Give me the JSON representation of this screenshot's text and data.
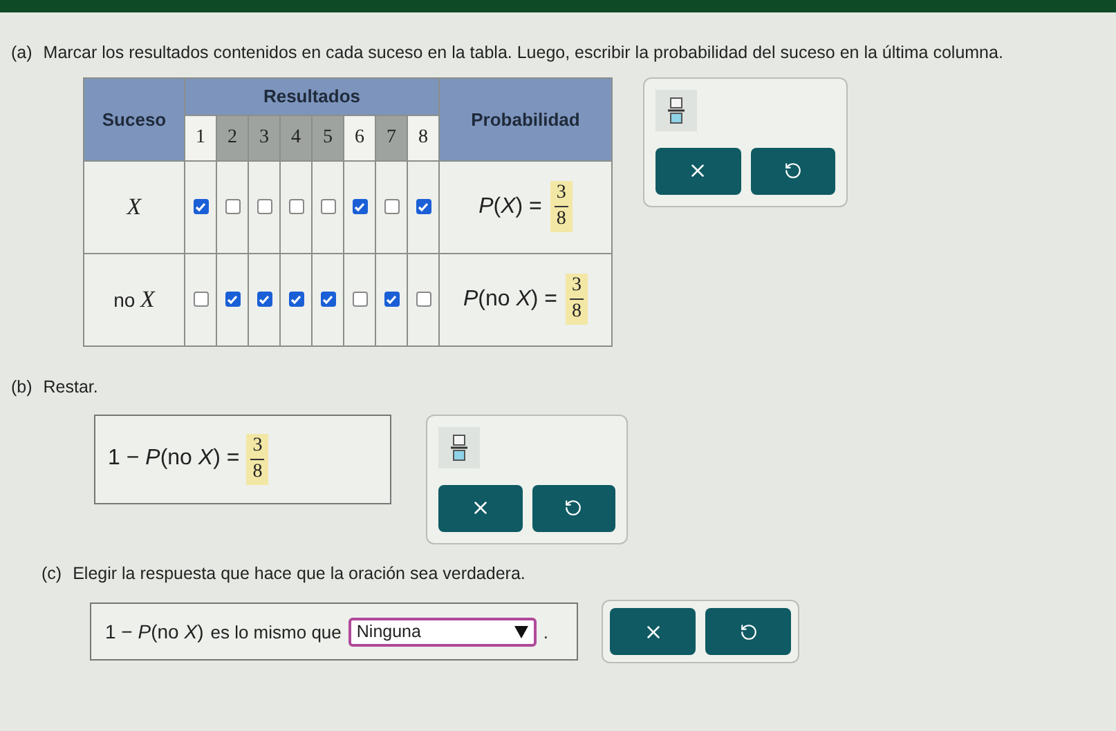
{
  "part_a": {
    "label": "(a)",
    "instruction": "Marcar los resultados contenidos en cada suceso en la tabla. Luego, escribir la probabilidad del suceso en la última columna.",
    "table": {
      "event_header": "Suceso",
      "outcomes_header": "Resultados",
      "probability_header": "Probabilidad",
      "outcomes": [
        {
          "label": "1",
          "shaded": false
        },
        {
          "label": "2",
          "shaded": true
        },
        {
          "label": "3",
          "shaded": true
        },
        {
          "label": "4",
          "shaded": true
        },
        {
          "label": "5",
          "shaded": true
        },
        {
          "label": "6",
          "shaded": false
        },
        {
          "label": "7",
          "shaded": true
        },
        {
          "label": "8",
          "shaded": false
        }
      ],
      "rows": [
        {
          "event_prefix": "",
          "event_var": "X",
          "checks": [
            true,
            false,
            false,
            false,
            false,
            true,
            false,
            true
          ],
          "expression": "*P*(*X*) =",
          "numerator": "3",
          "denominator": "8"
        },
        {
          "event_prefix": "no",
          "event_var": "X",
          "checks": [
            false,
            true,
            true,
            true,
            true,
            false,
            true,
            false
          ],
          "expression": "*P*(no *X*) =",
          "numerator": "3",
          "denominator": "8"
        }
      ]
    }
  },
  "part_b": {
    "label": "(b)",
    "instruction": "Restar.",
    "expression": "1 − *P*(no *X*) =",
    "numerator": "3",
    "denominator": "8"
  },
  "part_c": {
    "label": "(c)",
    "instruction": "Elegir la respuesta que hace que la oración sea verdadera.",
    "expression": "1 − *P*(no *X*)",
    "middle": "es lo mismo que",
    "dropdown_value": "Ninguna",
    "end": "."
  }
}
